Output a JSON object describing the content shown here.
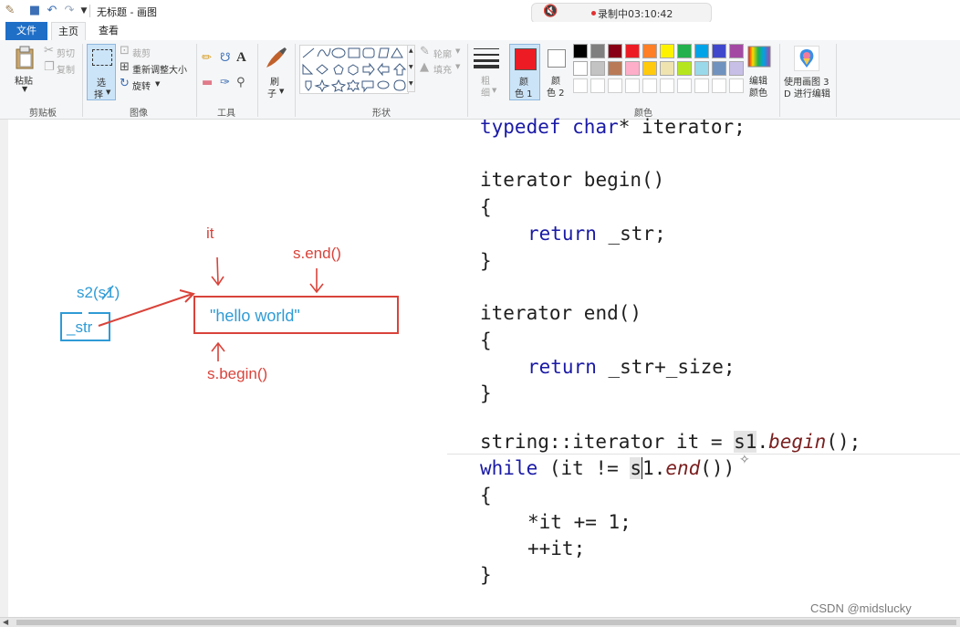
{
  "titlebar": {
    "title": "无标题 - 画图",
    "recording": "录制中03:10:42",
    "icons": [
      "paint-app-icon",
      "save-icon",
      "undo-icon",
      "redo-icon",
      "customize-dropdown-icon",
      "speaker-muted-icon"
    ]
  },
  "tabs": [
    "文件",
    "主页",
    "查看"
  ],
  "ribbon": {
    "clipboard": {
      "paste": "粘贴",
      "cut": "剪切",
      "copy": "复制",
      "label": "剪贴板"
    },
    "image": {
      "select_top": "选",
      "select_bottom": "择",
      "crop": "裁剪",
      "resize": "重新调整大小",
      "rotate": "旋转",
      "label": "图像"
    },
    "tools": {
      "label": "工具"
    },
    "brush": {
      "top": "刷",
      "bottom": "子"
    },
    "shapes": {
      "outline": "轮廓",
      "fill": "填充",
      "label": "形状"
    },
    "size": {
      "top": "粗",
      "bottom": "细"
    },
    "colors": {
      "color1_top": "颜",
      "color1_bottom": "色 1",
      "color2_top": "颜",
      "color2_bottom": "色 2",
      "edit_top": "编辑",
      "edit_bottom": "颜色",
      "paint3d_top": "使用画图 3",
      "paint3d_bottom": "D 进行编辑",
      "label": "颜色",
      "color1_value": "#ed1c24",
      "color2_value": "#ffffff",
      "palette_row1": [
        "#000000",
        "#7f7f7f",
        "#880015",
        "#ed1c24",
        "#ff7f27",
        "#fff200",
        "#22b14c",
        "#00a2e8",
        "#3f48cc",
        "#a349a4"
      ],
      "palette_row2": [
        "#ffffff",
        "#c3c3c3",
        "#b97a57",
        "#ffaec9",
        "#ffc90e",
        "#efe4b0",
        "#b5e61d",
        "#99d9ea",
        "#7092be",
        "#c8bfe7"
      ]
    }
  },
  "drawing": {
    "it_label": "it",
    "end_label": "s.end()",
    "s2_label": "s2(s1)",
    "str_label": "_str",
    "string_value": "\"hello world\"",
    "begin_label": "s.begin()"
  },
  "code": {
    "l1": [
      "typedef",
      " char",
      "*",
      " iterator;"
    ],
    "l2": [
      "iterator",
      " begin()"
    ],
    "brace_open": "{",
    "brace_close": "}",
    "ret1": [
      "return",
      " _str;"
    ],
    "l3": [
      "iterator",
      " end()"
    ],
    "ret2": [
      "return",
      " _str+_size;"
    ],
    "l4": [
      "string::iterator it = ",
      "s1",
      ".",
      "begin",
      "();"
    ],
    "l5": [
      "while",
      " (it != ",
      "s",
      "1",
      ".",
      "end",
      "())"
    ],
    "l6": [
      "*it += 1;"
    ],
    "l7": [
      "++it;"
    ]
  },
  "watermark": "CSDN @midslucky"
}
